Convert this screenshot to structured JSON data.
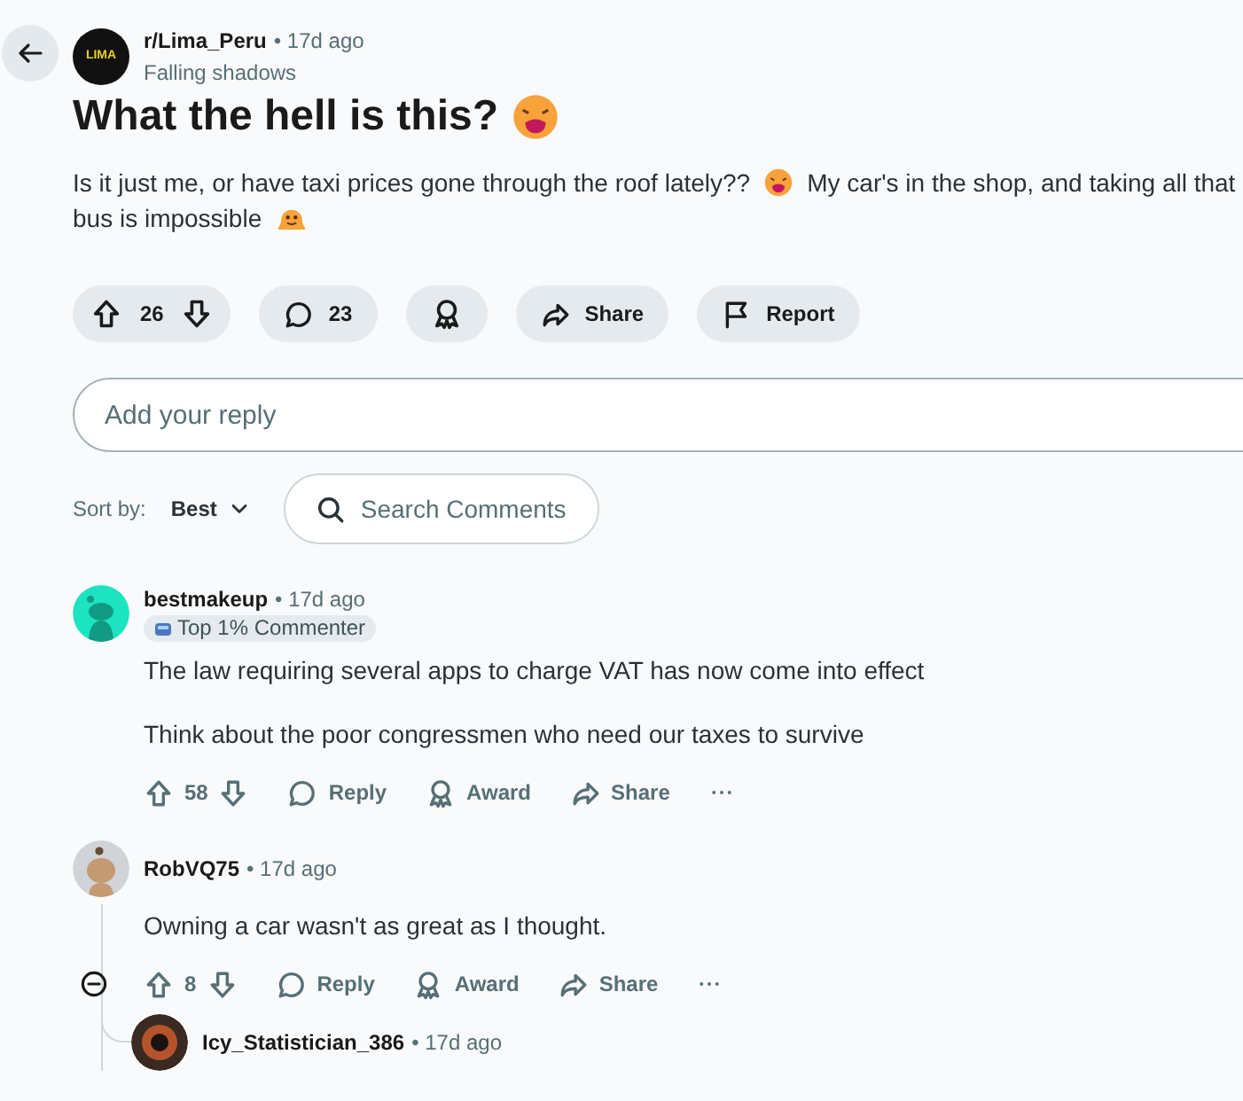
{
  "post": {
    "community": "r/Lima_Peru",
    "community_logo": "LIMA",
    "time": "• 17d ago",
    "flair": "Falling shadows",
    "title": "What the hell is this?",
    "body_lines": [
      "Is it just me, or have taxi prices gone through the roof lately??",
      "My car's in the shop, and taking all that",
      "bus is impossible"
    ],
    "votes": "26",
    "comments": "23",
    "share": "Share",
    "report": "Report"
  },
  "reply_field": {
    "placeholder": "Add your reply"
  },
  "sort": {
    "label": "Sort by:",
    "value": "Best"
  },
  "search": {
    "placeholder": "Search Comments"
  },
  "comments": [
    {
      "author": "bestmakeup",
      "time": "• 17d ago",
      "badge": "Top 1% Commenter",
      "paragraphs": [
        "The law requiring several apps to charge VAT has now come into effect",
        "Think about the poor congressmen who need our taxes to survive"
      ],
      "votes": "58",
      "actions": [
        "Reply",
        "Award",
        "Share"
      ]
    },
    {
      "author": "RobVQ75",
      "time": "• 17d ago",
      "paragraphs": [
        "Owning a car wasn't as great as I thought."
      ],
      "votes": "8",
      "actions": [
        "Reply",
        "Award",
        "Share"
      ],
      "expanded": true,
      "children": [
        {
          "author": "Icy_Statistician_386",
          "time": "• 17d ago"
        }
      ]
    }
  ]
}
